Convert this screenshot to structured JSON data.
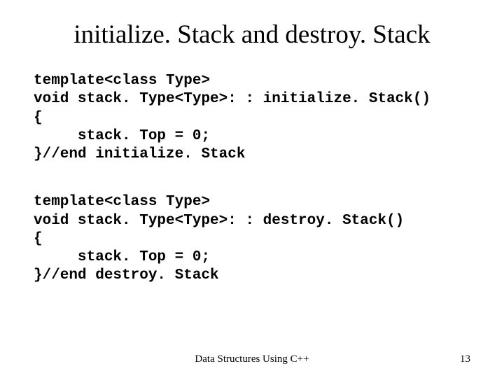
{
  "title": "initialize. Stack and destroy. Stack",
  "code1": "template<class Type>\nvoid stack. Type<Type>: : initialize. Stack()\n{\n     stack. Top = 0;\n}//end initialize. Stack",
  "code2": "template<class Type>\nvoid stack. Type<Type>: : destroy. Stack()\n{\n     stack. Top = 0;\n}//end destroy. Stack",
  "footer": {
    "center": "Data Structures Using C++",
    "page": "13"
  }
}
